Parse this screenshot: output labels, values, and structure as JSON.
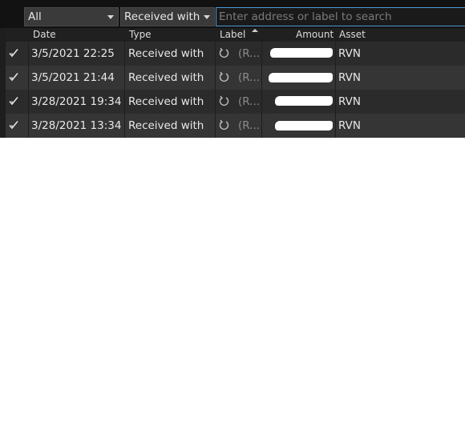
{
  "filters": {
    "type_selected": "All",
    "kind_selected": "Received with",
    "search_placeholder": "Enter address or label to search"
  },
  "columns": {
    "date": "Date",
    "type": "Type",
    "label": "Label",
    "amount": "Amount",
    "asset": "Asset"
  },
  "sort": {
    "column": "Label",
    "direction": "ascending"
  },
  "rows": [
    {
      "date": "3/5/2021 22:25",
      "type": "Received with",
      "label": "(R...",
      "amount": "",
      "asset": "RVN"
    },
    {
      "date": "3/5/2021 21:44",
      "type": "Received with",
      "label": "(R...",
      "amount": "",
      "asset": "RVN"
    },
    {
      "date": "3/28/2021 19:34",
      "type": "Received with",
      "label": "(R...",
      "amount": "",
      "asset": "RVN"
    },
    {
      "date": "3/28/2021 13:34",
      "type": "Received with",
      "label": "(R...",
      "amount": "",
      "asset": "RVN"
    }
  ],
  "icons": {
    "status": "confirmed-check-icon",
    "type": "received-arrow-icon",
    "sort": "sort-ascending-icon"
  },
  "colors": {
    "background": "#1e1e1e",
    "row_odd": "#2b2b2b",
    "row_even": "#353535",
    "accent": "#4e9ad6"
  }
}
